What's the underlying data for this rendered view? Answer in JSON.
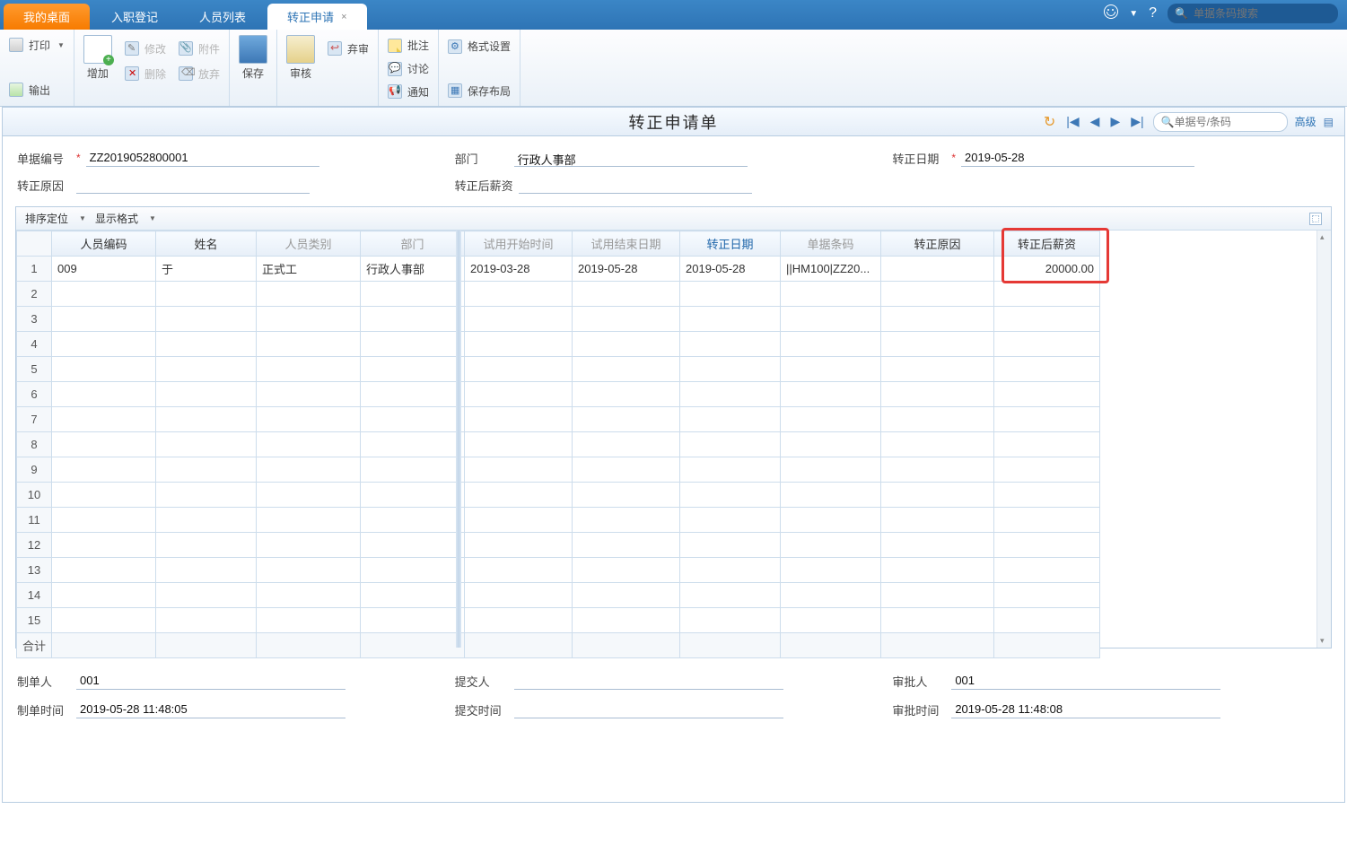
{
  "tabs": {
    "desktop": "我的桌面",
    "onboard": "入职登记",
    "personlist": "人员列表",
    "regular": "转正申请"
  },
  "topsearch": {
    "placeholder": "单据条码搜索"
  },
  "ribbon": {
    "print": "打印",
    "export": "输出",
    "add": "增加",
    "edit": "修改",
    "attach": "附件",
    "del": "删除",
    "aband": "放弃",
    "save": "保存",
    "audit": "审核",
    "discard": "弃审",
    "note": "批注",
    "discuss": "讨论",
    "notify": "通知",
    "fmt": "格式设置",
    "layout": "保存布局"
  },
  "doc": {
    "title": "转正申请单",
    "search_placeholder": "单据号/条码",
    "adv": "高级"
  },
  "header": {
    "docno_label": "单据编号",
    "docno_val": "ZZ2019052800001",
    "dept_label": "部门",
    "dept_val": "行政人事部",
    "date_label": "转正日期",
    "date_val": "2019-05-28",
    "reason_label": "转正原因",
    "reason_val": "",
    "salary_label": "转正后薪资",
    "salary_val": ""
  },
  "gridbar": {
    "sort": "排序定位",
    "dispfmt": "显示格式"
  },
  "cols": {
    "code": "人员编码",
    "name": "姓名",
    "ptype": "人员类别",
    "dept": "部门",
    "trial_start": "试用开始时间",
    "trial_end": "试用结束日期",
    "reg_date": "转正日期",
    "barcode": "单据条码",
    "reason": "转正原因",
    "salary": "转正后薪资"
  },
  "rows": [
    {
      "n": "1",
      "code": "009",
      "name": "于",
      "ptype": "正式工",
      "dept": "行政人事部",
      "trial_start": "2019-03-28",
      "trial_end": "2019-05-28",
      "reg_date": "2019-05-28",
      "barcode": "||HM100|ZZ20...",
      "reason": "",
      "salary": "20000.00"
    }
  ],
  "sum_label": "合计",
  "footer": {
    "maker_label": "制单人",
    "maker_val": "001",
    "submitter_label": "提交人",
    "submitter_val": "",
    "approver_label": "审批人",
    "approver_val": "001",
    "maketime_label": "制单时间",
    "maketime_val": "2019-05-28 11:48:05",
    "submittime_label": "提交时间",
    "submittime_val": "",
    "approvetime_label": "审批时间",
    "approvetime_val": "2019-05-28 11:48:08"
  }
}
